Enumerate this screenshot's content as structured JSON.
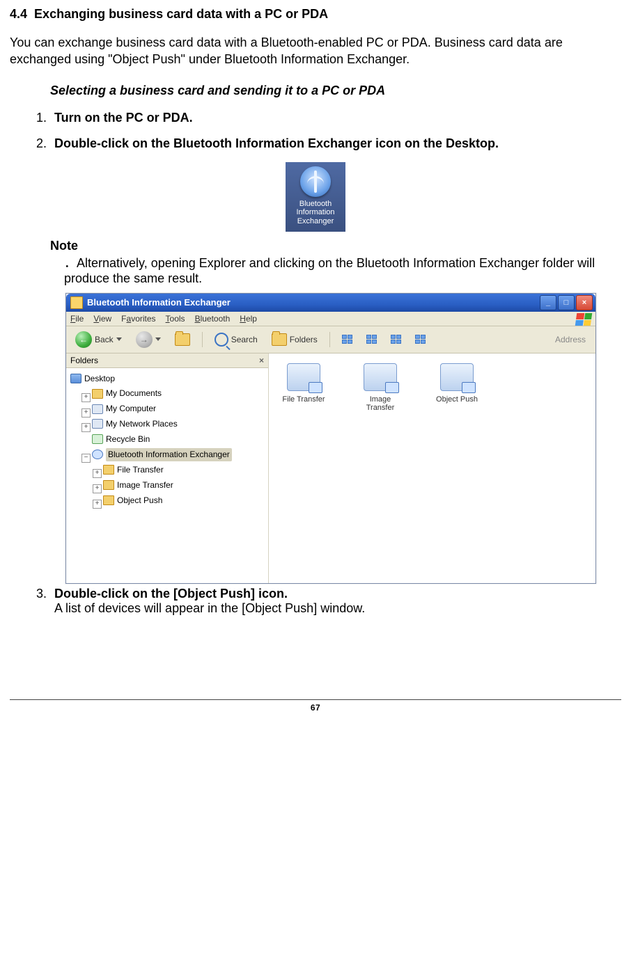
{
  "section": {
    "number": "4.4",
    "title": "Exchanging business card data with a PC or PDA"
  },
  "intro": "You can exchange business card data with a Bluetooth-enabled PC or PDA. Business card data are exchanged using \"Object Push\" under Bluetooth Information Exchanger.",
  "subheading": "Selecting a business card and sending it to a PC or PDA",
  "steps": {
    "1": "Turn on the PC or PDA.",
    "2": "Double-click on the Bluetooth Information Exchanger icon on the Desktop.",
    "3": "Double-click on the [Object Push] icon.",
    "3_detail": "A list of devices will appear in the [Object Push] window."
  },
  "desktop_icon": {
    "line1": "Bluetooth",
    "line2": "Information",
    "line3": "Exchanger"
  },
  "note": {
    "label": "Note",
    "bullet": "．",
    "text": "Alternatively, opening Explorer and clicking on the Bluetooth Information Exchanger folder will produce the same result."
  },
  "explorer": {
    "title": "Bluetooth Information Exchanger",
    "min": "_",
    "max": "□",
    "close": "×",
    "menus": [
      "File",
      "View",
      "Favorites",
      "Tools",
      "Bluetooth",
      "Help"
    ],
    "back": "Back",
    "search": "Search",
    "folders": "Folders",
    "address": "Address",
    "sidebar_title": "Folders",
    "tree": {
      "desktop": "Desktop",
      "mydocs": "My Documents",
      "mycomp": "My Computer",
      "mynet": "My Network Places",
      "recycle": "Recycle Bin",
      "bie": "Bluetooth Information Exchanger",
      "ft": "File Transfer",
      "it": "Image Transfer",
      "op": "Object Push"
    },
    "content_icons": {
      "ft": "File Transfer",
      "it": "Image\nTransfer",
      "op": "Object Push"
    }
  },
  "page_number": "67"
}
